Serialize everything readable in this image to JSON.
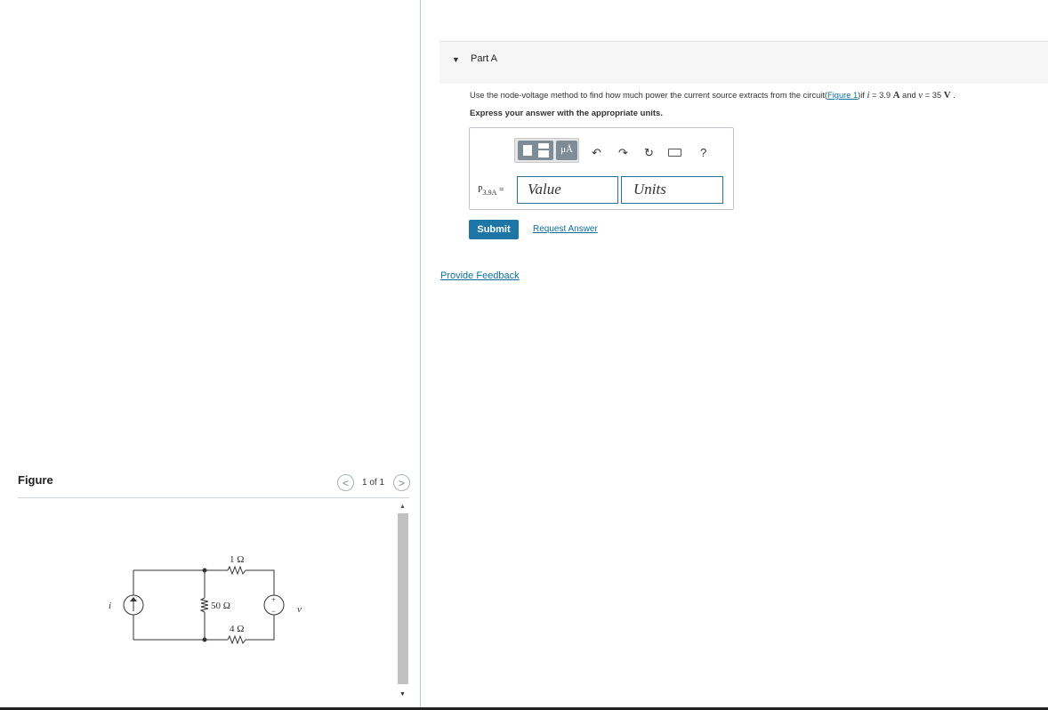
{
  "figure": {
    "title": "Figure",
    "page_counter": "1 of 1",
    "prev_glyph": "<",
    "next_glyph": ">",
    "scroll_up_glyph": "▲",
    "scroll_down_glyph": "▼",
    "circuit": {
      "current_source_label": "i",
      "resistor_top": "1 Ω",
      "resistor_middle": "50 Ω",
      "resistor_bottom": "4 Ω",
      "voltage_source_label": "v",
      "plus": "+",
      "minus": "−"
    }
  },
  "part_a": {
    "caret": "▼",
    "title": "Part A",
    "question_pre": "Use the node-voltage method to find how much power the current source extracts from the circuit(",
    "figure_link": "Figure 1",
    "question_mid1": ")if ",
    "var_i": "i",
    "question_mid2": " = 3.9 ",
    "unit_a": "A",
    "question_mid3": " and ",
    "var_v": "v",
    "question_mid4": " = 35 ",
    "unit_v": "V",
    "question_end": " .",
    "express": "Express your answer with the appropriate units.",
    "toolbar": {
      "units_button": "μÅ",
      "undo_glyph": "↶",
      "redo_glyph": "↷",
      "reset_glyph": "↻",
      "help": "?"
    },
    "answer_label_main": "P",
    "answer_label_sub": "3.9A",
    "answer_label_eq": " =",
    "value_placeholder": "Value",
    "units_placeholder": "Units",
    "submit": "Submit",
    "request_answer": "Request Answer"
  },
  "feedback": "Provide Feedback",
  "colors": {
    "accent": "#1d76a5",
    "link": "#0b6e9f",
    "divider": "#b7cbd9"
  }
}
